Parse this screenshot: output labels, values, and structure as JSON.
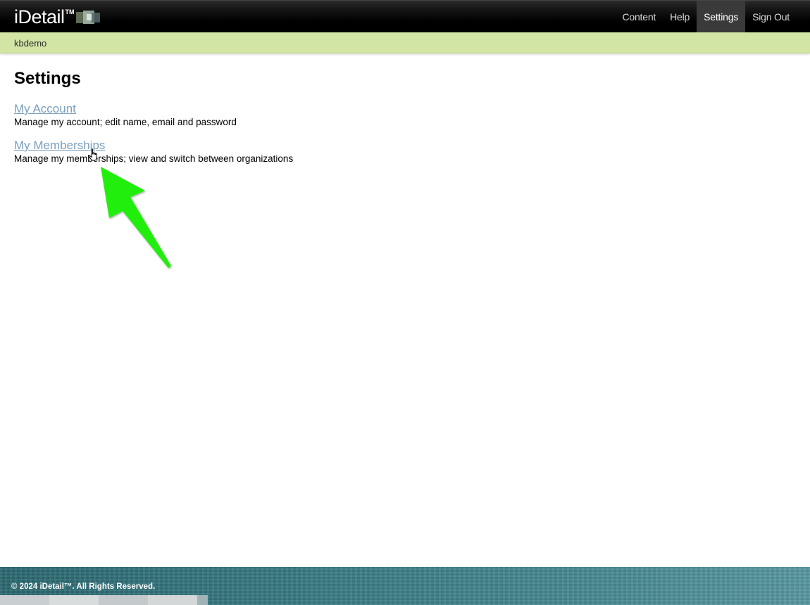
{
  "header": {
    "logo_text": "iDetail",
    "logo_tm": "TM",
    "nav": [
      {
        "label": "Content",
        "active": false
      },
      {
        "label": "Help",
        "active": false
      },
      {
        "label": "Settings",
        "active": true
      },
      {
        "label": "Sign Out",
        "active": false
      }
    ]
  },
  "subbar": {
    "username": "kbdemo"
  },
  "main": {
    "title": "Settings",
    "items": [
      {
        "link": "My Account",
        "description": "Manage my account; edit name, email and password"
      },
      {
        "link": "My Memberships",
        "description": "Manage my memberships; view and switch between organizations"
      }
    ]
  },
  "footer": {
    "copyright": "© 2024 iDetail™.  All Rights Reserved."
  },
  "colors": {
    "topbar": "#000000",
    "active_nav": "#3a3a3a",
    "subbar": "#d2e5a5",
    "link": "#7a9fbd",
    "annotation_arrow": "#22ee11",
    "footer": "#3b7d86"
  },
  "icons": {
    "cursor": "hand-pointer-icon",
    "annotation": "green-arrow-icon"
  }
}
